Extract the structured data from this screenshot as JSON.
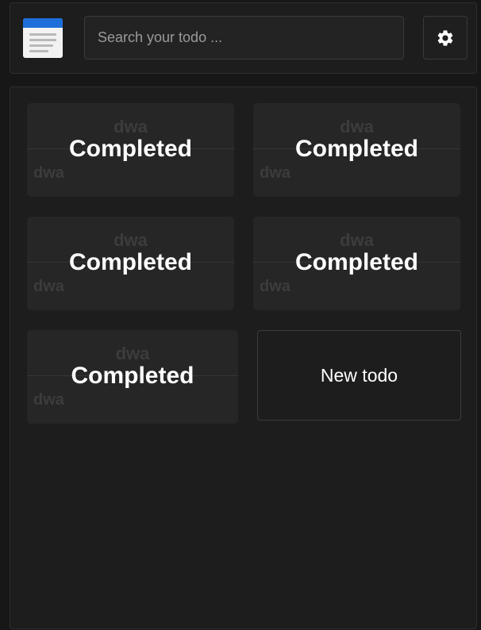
{
  "search": {
    "placeholder": "Search your todo ..."
  },
  "icons": {
    "logo": "notes-app-icon",
    "settings": "gear-icon"
  },
  "colors": {
    "background": "#171717",
    "panel": "#1d1d1d",
    "card": "#262626",
    "logo_accent": "#1e6fd9"
  },
  "cards": [
    {
      "title": "dwa",
      "description": "dwa",
      "status": "Completed"
    },
    {
      "title": "dwa",
      "description": "dwa",
      "status": "Completed"
    },
    {
      "title": "dwa",
      "description": "dwa",
      "status": "Completed"
    },
    {
      "title": "dwa",
      "description": "dwa",
      "status": "Completed"
    },
    {
      "title": "dwa",
      "description": "dwa",
      "status": "Completed"
    }
  ],
  "new_todo": {
    "label": "New todo"
  }
}
